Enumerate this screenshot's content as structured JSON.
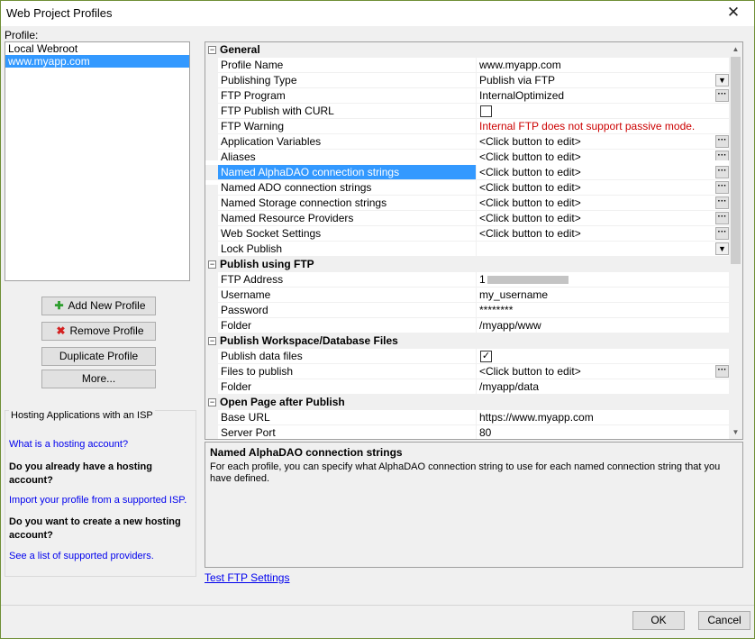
{
  "window": {
    "title": "Web Project Profiles"
  },
  "profile_label": "Profile:",
  "profiles": [
    "Local Webroot",
    "www.myapp.com"
  ],
  "buttons": {
    "add_profile": "Add New Profile",
    "remove_profile": "Remove Profile",
    "duplicate_profile": "Duplicate Profile",
    "more": "More...",
    "ok": "OK",
    "cancel": "Cancel"
  },
  "hosting": {
    "title": "Hosting Applications with an ISP",
    "link_what": "What is a hosting account?",
    "q_have": "Do you already have a hosting account?",
    "link_import": "Import your profile from a supported ISP.",
    "q_new": "Do you want to create a new hosting account?",
    "link_list": "See a list of supported providers."
  },
  "grid": {
    "general": {
      "title": "General",
      "profile_name": [
        "Profile Name",
        "www.myapp.com"
      ],
      "publishing_type": [
        "Publishing Type",
        "Publish via FTP"
      ],
      "ftp_program": [
        "FTP Program",
        "InternalOptimized"
      ],
      "ftp_curl": [
        "FTP Publish with CURL",
        ""
      ],
      "ftp_warning": [
        "FTP Warning",
        "Internal FTP does not support passive mode."
      ],
      "app_vars": [
        "Application Variables",
        "<Click button to edit>"
      ],
      "aliases": [
        "Aliases",
        "<Click button to edit>"
      ],
      "alphadao": [
        "Named AlphaDAO connection strings",
        "<Click button to edit>"
      ],
      "ado": [
        "Named ADO connection strings",
        "<Click button to edit>"
      ],
      "storage": [
        "Named Storage connection strings",
        "<Click button to edit>"
      ],
      "resource": [
        "Named Resource Providers",
        "<Click button to edit>"
      ],
      "websocket": [
        "Web Socket Settings",
        "<Click button to edit>"
      ],
      "lock": [
        "Lock Publish",
        ""
      ]
    },
    "ftp": {
      "title": "Publish using FTP",
      "address": [
        "FTP Address",
        "1"
      ],
      "username": [
        "Username",
        "my_username"
      ],
      "password": [
        "Password",
        "********"
      ],
      "folder": [
        "Folder",
        "/myapp/www"
      ]
    },
    "workspace": {
      "title": "Publish Workspace/Database Files",
      "data_files": [
        "Publish data files",
        ""
      ],
      "files": [
        "Files to publish",
        "<Click button to edit>"
      ],
      "folder": [
        "Folder",
        "/myapp/data"
      ]
    },
    "open_page": {
      "title": "Open Page after Publish",
      "base_url": [
        "Base URL",
        "https://www.myapp.com"
      ],
      "port": [
        "Server Port",
        "80"
      ]
    }
  },
  "description": {
    "title": "Named AlphaDAO connection strings",
    "text": "For each profile, you can specify what AlphaDAO connection string to use for each named connection string that you have defined."
  },
  "test_ftp": "Test FTP Settings"
}
